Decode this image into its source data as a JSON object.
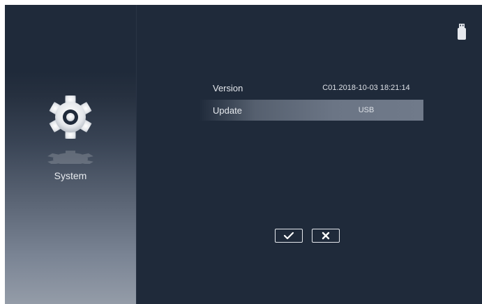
{
  "sidebar": {
    "section_label": "System",
    "icon": "gear-icon"
  },
  "status": {
    "usb_icon": "usb-drive-icon"
  },
  "settings": {
    "rows": [
      {
        "label": "Version",
        "value": "C01.2018-10-03 18:21:14"
      },
      {
        "label": "Update",
        "value": "USB"
      }
    ]
  },
  "actions": {
    "confirm_icon": "checkmark-icon",
    "cancel_icon": "close-icon"
  },
  "colors": {
    "background": "#1f2a3a",
    "highlight": "#6b7585",
    "text": "#e6e9ee"
  }
}
